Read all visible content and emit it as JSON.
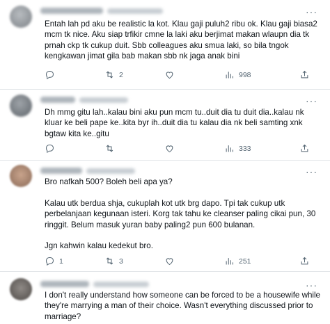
{
  "posts": [
    {
      "text": "Entah lah pd aku be realistic la kot. Klau gaji puluh2 ribu ok. Klau gaji biasa2 mcm tk nice. Aku siap trfikir cmne la laki aku berjimat makan wlaupn dia tk prnah ckp tk cukup duit. Sbb colleagues aku smua laki, so bila tngok kengkawan jimat gila bab makan sbb nk jaga anak bini",
      "replies": "",
      "reposts": "2",
      "likes": "",
      "views": "998"
    },
    {
      "text": "Dh mmg gitu lah..kalau bini aku pun mcm tu..duit dia tu duit dia..kalau nk kluar ke beli pape ke..kita byr ih..duit dia tu kalau dia nk beli samting xnk bgtaw kita ke..gitu",
      "replies": "",
      "reposts": "",
      "likes": "",
      "views": "333"
    },
    {
      "text": "Bro nafkah 500? Boleh beli apa ya?\n\nKalau utk berdua shja, cukuplah kot utk brg dapo. Tpi tak cukup utk perbelanjaan kegunaan isteri. Korg tak tahu ke cleanser paling cikai pun, 30 ringgit. Belum masuk yuran baby paling2 pun 600 bulanan.\n\nJgn kahwin kalau kedekut bro.",
      "replies": "1",
      "reposts": "3",
      "likes": "",
      "views": "251"
    },
    {
      "text": "I don't really understand how someone can be forced to be a housewife while they're marrying a man of their choice. Wasn't everything discussed prior to marriage?"
    }
  ],
  "colors": {
    "text": "#0f1419",
    "muted": "#536471",
    "divider": "#e3e6e9"
  },
  "icons": [
    "reply-icon",
    "repost-icon",
    "like-icon",
    "views-icon",
    "share-icon",
    "more-icon"
  ]
}
